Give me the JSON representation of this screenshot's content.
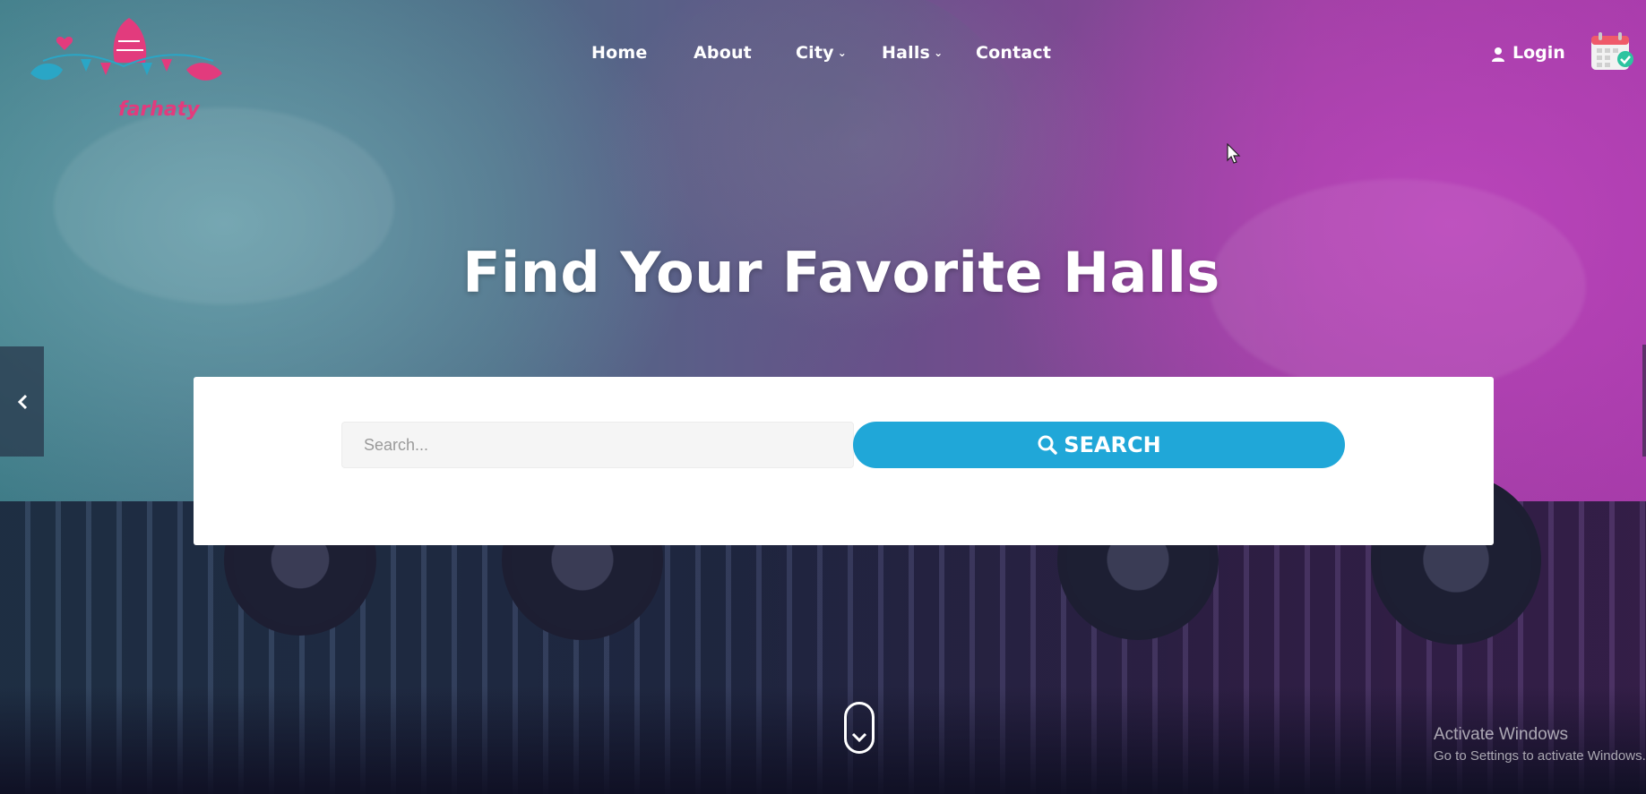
{
  "brand": {
    "name": "farhaty"
  },
  "nav": {
    "items": [
      {
        "label": "Home",
        "has_dropdown": false
      },
      {
        "label": "About",
        "has_dropdown": false
      },
      {
        "label": "City",
        "has_dropdown": true
      },
      {
        "label": "Halls",
        "has_dropdown": true
      },
      {
        "label": "Contact",
        "has_dropdown": false
      }
    ],
    "login_label": "Login"
  },
  "hero": {
    "title": "Find Your Favorite Halls"
  },
  "search": {
    "placeholder": "Search...",
    "value": "",
    "button_label": "SEARCH"
  },
  "icons": {
    "user": "user-icon",
    "calendar": "calendar-icon",
    "search": "search-icon",
    "prev": "chevron-left-icon",
    "scroll": "chevron-down-icon"
  },
  "colors": {
    "accent": "#20a7d8",
    "brand_pink": "#e23b7d",
    "brand_teal": "#2aa6c6"
  },
  "os_watermark": {
    "title": "Activate Windows",
    "subtitle": "Go to Settings to activate Windows."
  }
}
